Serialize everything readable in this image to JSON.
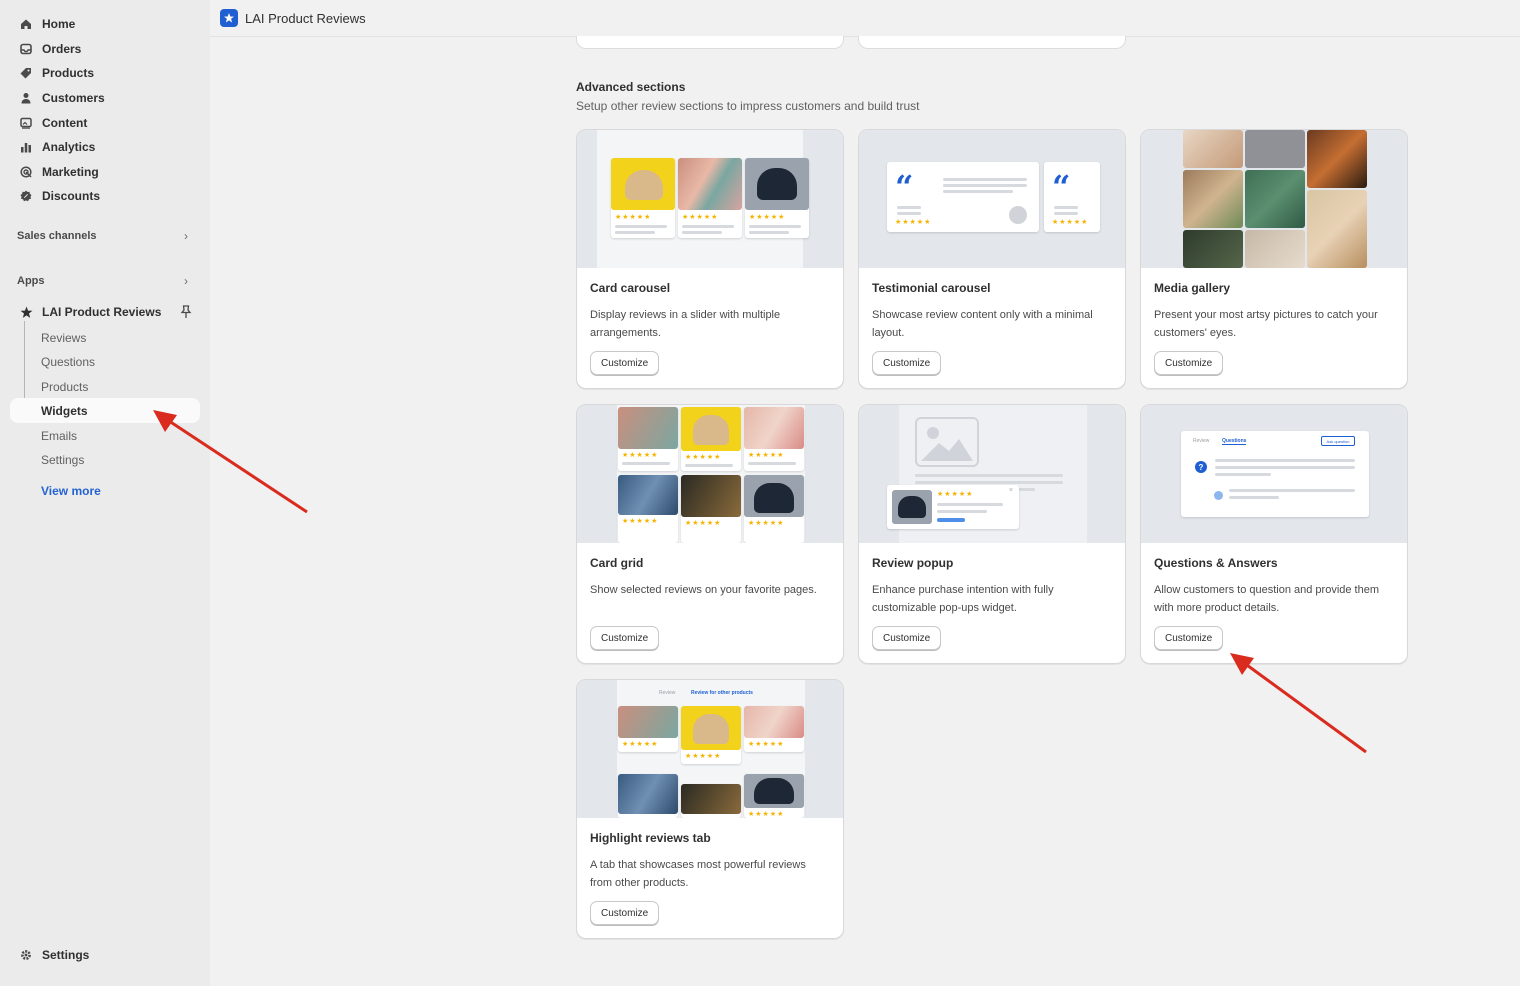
{
  "sidebar": {
    "nav": [
      {
        "label": "Home",
        "icon": "home-icon"
      },
      {
        "label": "Orders",
        "icon": "inbox-icon"
      },
      {
        "label": "Products",
        "icon": "tag-icon"
      },
      {
        "label": "Customers",
        "icon": "person-icon"
      },
      {
        "label": "Content",
        "icon": "image-icon"
      },
      {
        "label": "Analytics",
        "icon": "bar-chart-icon"
      },
      {
        "label": "Marketing",
        "icon": "target-icon"
      },
      {
        "label": "Discounts",
        "icon": "discount-icon"
      }
    ],
    "sales_channels": "Sales channels",
    "apps": "Apps",
    "app_name": "LAI Product Reviews",
    "sub_items": [
      "Reviews",
      "Questions",
      "Products",
      "Widgets",
      "Emails",
      "Settings"
    ],
    "view_more": "View more",
    "settings": "Settings"
  },
  "topbar": {
    "title": "LAI Product Reviews"
  },
  "section": {
    "title": "Advanced sections",
    "subtitle": "Setup other review sections to impress customers and build trust"
  },
  "cards": [
    {
      "title": "Card carousel",
      "desc": "Display reviews in a slider with multiple arrangements.",
      "button": "Customize"
    },
    {
      "title": "Testimonial carousel",
      "desc": "Showcase review content only with a minimal layout.",
      "button": "Customize"
    },
    {
      "title": "Media gallery",
      "desc": "Present your most artsy pictures to catch your customers' eyes.",
      "button": "Customize"
    },
    {
      "title": "Card grid",
      "desc": "Show selected reviews on your favorite pages.",
      "button": "Customize"
    },
    {
      "title": "Review popup",
      "desc": "Enhance purchase intention with fully customizable pop-ups widget.",
      "button": "Customize"
    },
    {
      "title": "Questions & Answers",
      "desc": "Allow customers to question and provide them with more product details.",
      "button": "Customize"
    },
    {
      "title": "Highlight reviews tab",
      "desc": "A tab that showcases most powerful reviews from other products.",
      "button": "Customize"
    }
  ],
  "thumbs": {
    "stars": "★★★★★",
    "qa_tab_review": "Review",
    "qa_tab_questions": "Questions",
    "qa_ask": "Ask question",
    "highlight_tab_review": "Review",
    "highlight_tab_other": "Review for other products"
  },
  "colors": {
    "accent": "#2463d0",
    "annotation_arrow": "#d92b1e",
    "star": "#f5b400"
  }
}
